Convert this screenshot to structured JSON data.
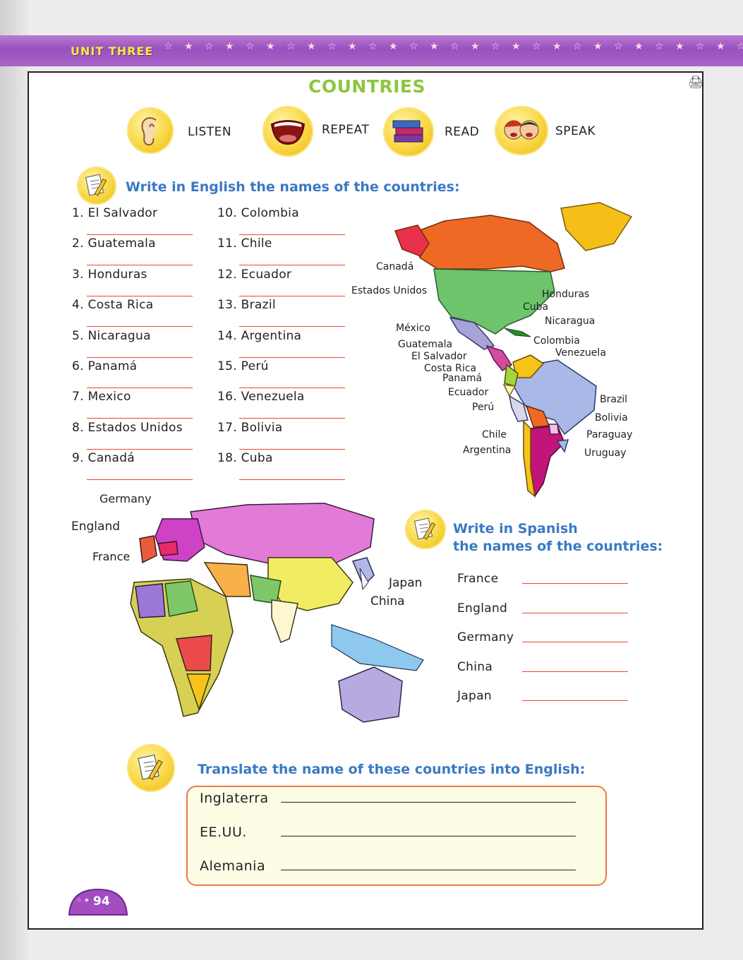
{
  "banner": {
    "title": "UNIT THREE",
    "stars": "☆ ★ ☆ ★ ☆ ★ ☆ ★ ☆ ★ ☆ ★ ☆ ★ ☆ ★ ☆ ★ ☆ ★ ☆ ★ ☆ ★ ☆ ★ ☆ ★ ☆ ★"
  },
  "title": "COUNTRIES",
  "skills": [
    {
      "label": "LISTEN",
      "icon": "ear-icon"
    },
    {
      "label": "REPEAT",
      "icon": "mouth-icon"
    },
    {
      "label": "READ",
      "icon": "books-icon"
    },
    {
      "label": "SPEAK",
      "icon": "kids-icon"
    }
  ],
  "section1": {
    "instruction": "Write in English the names of the countries:",
    "col1": [
      "1. El Salvador",
      "2. Guatemala",
      "3. Honduras",
      "4. Costa Rica",
      "5. Nicaragua",
      "6. Panamá",
      "7. Mexico",
      "8. Estados Unidos",
      "9. Canadá"
    ],
    "col2": [
      "10. Colombia",
      "11. Chile",
      "12. Ecuador",
      "13. Brazil",
      "14. Argentina",
      "15. Perú",
      "16. Venezuela",
      "17. Bolivia",
      "18. Cuba"
    ]
  },
  "americas_labels": {
    "canada": "Canadá",
    "usa": "Estados Unidos",
    "honduras": "Honduras",
    "cuba": "Cuba",
    "mexico": "México",
    "nicaragua": "Nicaragua",
    "guatemala": "Guatemala",
    "colombia": "Colombia",
    "elsalvador": "El Salvador",
    "venezuela": "Venezuela",
    "costarica": "Costa Rica",
    "panama": "Panamá",
    "ecuador": "Ecuador",
    "brazil": "Brazil",
    "peru": "Perú",
    "bolivia": "Bolivia",
    "chile": "Chile",
    "paraguay": "Paraguay",
    "argentina": "Argentina",
    "uruguay": "Uruguay"
  },
  "eurasia_labels": {
    "germany": "Germany",
    "england": "England",
    "france": "France",
    "japan": "Japan",
    "china": "China"
  },
  "section2": {
    "instruction_line1": "Write in Spanish",
    "instruction_line2": "the names of the countries:",
    "items": [
      "France",
      "England",
      "Germany",
      "China",
      "Japan"
    ]
  },
  "section3": {
    "instruction": "Translate the name of these countries into English:",
    "items": [
      "Inglaterra",
      "EE.UU.",
      "Alemania"
    ]
  },
  "page_number": "94"
}
